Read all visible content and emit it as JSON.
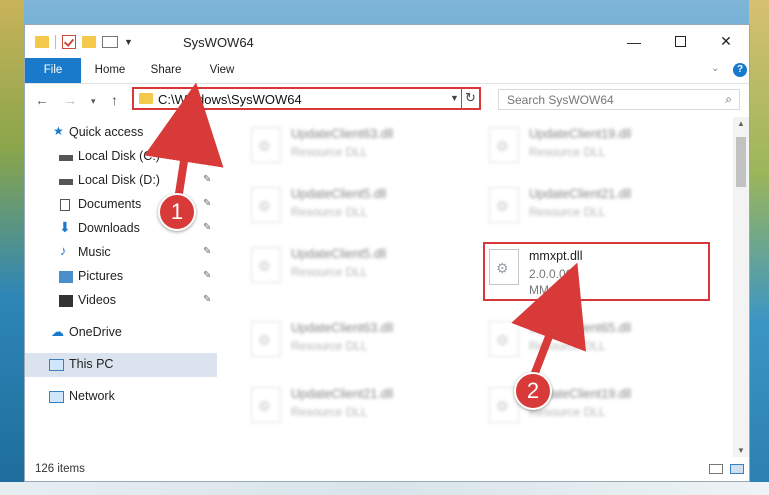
{
  "window": {
    "title": "SysWOW64",
    "controls": {
      "minimize": "—",
      "maximize": "",
      "close": "✕"
    }
  },
  "ribbon": {
    "tabs": [
      {
        "label": "File"
      },
      {
        "label": "Home"
      },
      {
        "label": "Share"
      },
      {
        "label": "View"
      }
    ],
    "help": "?"
  },
  "navigation": {
    "address": "C:\\Windows\\SysWOW64",
    "search_placeholder": "Search SysWOW64"
  },
  "sidebar": {
    "items": [
      {
        "label": "Quick access",
        "icon": "star-icon",
        "pinned": false
      },
      {
        "label": "Local Disk (C:)",
        "icon": "drive-icon",
        "pinned": true
      },
      {
        "label": "Local Disk (D:)",
        "icon": "drive-icon",
        "pinned": true
      },
      {
        "label": "Documents",
        "icon": "documents-icon",
        "pinned": true
      },
      {
        "label": "Downloads",
        "icon": "download-icon",
        "pinned": true
      },
      {
        "label": "Music",
        "icon": "music-icon",
        "pinned": true
      },
      {
        "label": "Pictures",
        "icon": "pictures-icon",
        "pinned": true
      },
      {
        "label": "Videos",
        "icon": "videos-icon",
        "pinned": true
      },
      {
        "label": "OneDrive",
        "icon": "cloud-icon",
        "pinned": false
      },
      {
        "label": "This PC",
        "icon": "computer-icon",
        "pinned": false,
        "selected": true
      },
      {
        "label": "Network",
        "icon": "network-icon",
        "pinned": false
      }
    ]
  },
  "files": [
    {
      "name": "UpdateClient63.dll",
      "sub": "Resource DLL"
    },
    {
      "name": "UpdateClient19.dll",
      "sub": "Resource DLL"
    },
    {
      "name": "UpdateClient5.dll",
      "sub": "Resource DLL"
    },
    {
      "name": "UpdateClient21.dll",
      "sub": "Resource DLL"
    },
    {
      "name": "UpdateClient5.dll",
      "sub": "Resource DLL"
    },
    {
      "name": "mmxpt.dll",
      "sub": "2.0.0.001",
      "sub2": "MMxpt",
      "highlight": true
    },
    {
      "name": "UpdateClient63.dll",
      "sub": "Resource DLL"
    },
    {
      "name": "UpdateClient65.dll",
      "sub": "Resource DLL"
    },
    {
      "name": "UpdateClient21.dll",
      "sub": "Resource DLL"
    },
    {
      "name": "UpdateClient19.dll",
      "sub": "Resource DLL"
    }
  ],
  "status": {
    "item_count": "126 items"
  },
  "markers": [
    "1",
    "2"
  ],
  "colors": {
    "accent": "#1979ca",
    "highlight_red": "#d9383a"
  }
}
